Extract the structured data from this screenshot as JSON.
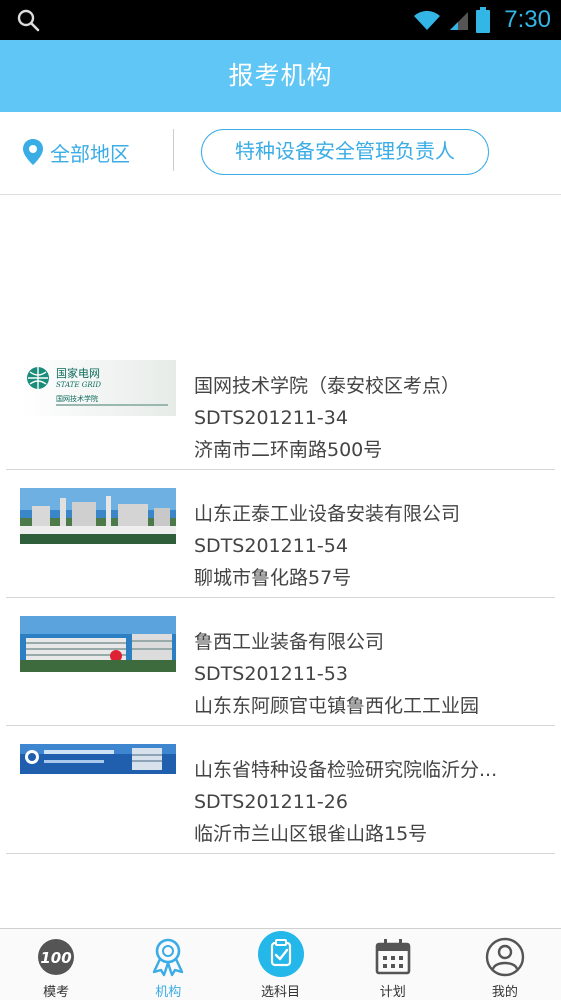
{
  "status_bar": {
    "time": "7:30"
  },
  "header": {
    "title": "报考机构"
  },
  "filter": {
    "region_label": "全部地区",
    "subject_label": "特种设备安全管理负责人"
  },
  "institutions": [
    {
      "name": "国网技术学院（泰安校区考点）",
      "code": "SDTS201211-34",
      "address": "济南市二环南路500号",
      "logo_text": "国家电网",
      "logo_sub": "STATE GRID",
      "logo_sub2": "国网技术学院"
    },
    {
      "name": "山东正泰工业设备安装有限公司",
      "code": "SDTS201211-54",
      "address": "聊城市鲁化路57号"
    },
    {
      "name": "鲁西工业装备有限公司",
      "code": "SDTS201211-53",
      "address": "山东东阿顾官屯镇鲁西化工工业园"
    },
    {
      "name": "山东省特种设备检验研究院临沂分...",
      "code": "SDTS201211-26",
      "address": "临沂市兰山区银雀山路15号"
    }
  ],
  "nav": {
    "exam": "模考",
    "institution": "机构",
    "subject": "选科目",
    "plan": "计划",
    "mine": "我的"
  },
  "colors": {
    "accent": "#3aace6",
    "title_bar": "#5fc6f5"
  }
}
